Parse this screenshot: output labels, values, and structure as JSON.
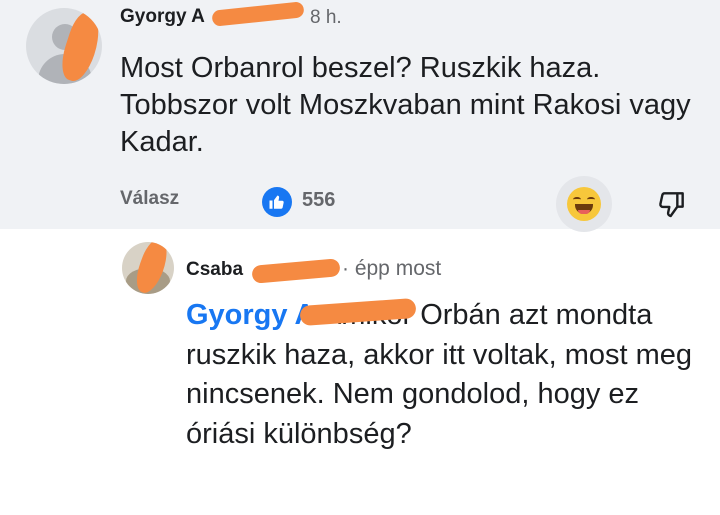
{
  "comment": {
    "author": "Gyorgy A",
    "time": "8 h.",
    "text": "Most Orbanrol beszel? Ruszkik haza. Tobbszor volt Moszkvaban mint Rakosi vagy Kadar.",
    "reply_label": "Válasz",
    "like_count": "556",
    "reaction_icon": "haha-emoji-icon",
    "dislike_icon": "thumbs-down-icon"
  },
  "reply": {
    "author": "Csaba",
    "time": "· épp most",
    "mention": "Gyorgy A",
    "text": "Amikor Orbán azt mondta ruszkik haza, akkor itt voltak, most meg nincsenek. Nem gondolod, hogy ez óriási különbség?"
  },
  "colors": {
    "mention": "#1877f2",
    "redaction": "#f58a42",
    "top_background": "#f0f2f5"
  }
}
